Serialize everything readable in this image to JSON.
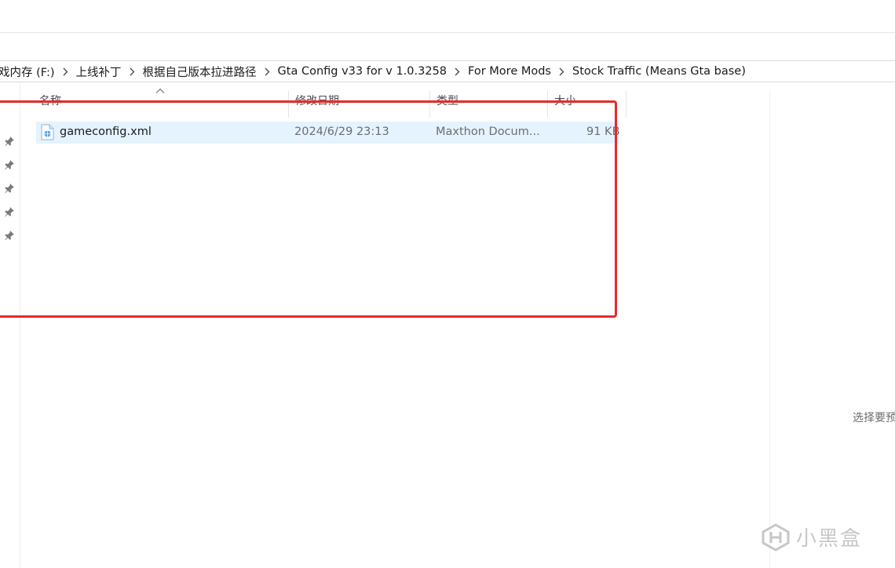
{
  "address_bar": {
    "crumbs": [
      "戏内存 (F:)",
      "上线补丁",
      "根据自己版本拉进路径",
      "Gta Config v33 for v 1.0.3258",
      "For More Mods",
      "Stock Traffic (Means Gta base)"
    ]
  },
  "columns": {
    "name": "名称",
    "modified": "修改日期",
    "type": "类型",
    "size": "大小"
  },
  "files": [
    {
      "name": "gameconfig.xml",
      "modified": "2024/6/29 23:13",
      "type": "Maxthon Docum...",
      "size": "91 KB",
      "icon": "xml-file-icon"
    }
  ],
  "preview_pane": {
    "text": "选择要预"
  },
  "watermark": {
    "text": "小黑盒",
    "icon": "xiaoheihe-logo"
  },
  "colors": {
    "selection": "#e5f3ff",
    "highlight_box": "#e52b2b"
  }
}
